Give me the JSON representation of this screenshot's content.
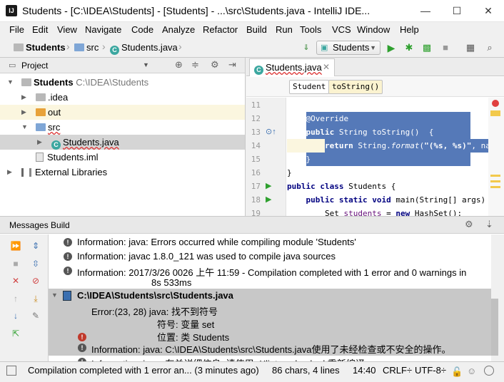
{
  "window": {
    "title": "Students - [C:\\IDEA\\Students] - [Students] - ...\\src\\Students.java - IntelliJ IDE...",
    "minimize": "—",
    "maximize": "☐",
    "close": "✕"
  },
  "menu": [
    "File",
    "Edit",
    "View",
    "Navigate",
    "Code",
    "Analyze",
    "Refactor",
    "Build",
    "Run",
    "Tools",
    "VCS",
    "Window",
    "Help"
  ],
  "navbar": {
    "crumbs": [
      "Students",
      "src",
      "Students.java"
    ],
    "run_config": "Students"
  },
  "project": {
    "header": "Project",
    "tree": [
      {
        "label": "Students",
        "extra": "C:\\IDEA\\Students"
      },
      {
        "label": ".idea"
      },
      {
        "label": "out"
      },
      {
        "label": "src"
      },
      {
        "label": "Students.java"
      },
      {
        "label": "Students.iml"
      },
      {
        "label": "External Libraries"
      }
    ]
  },
  "editor": {
    "tab": "Students.java",
    "crumbs": [
      "Student",
      "toString()"
    ],
    "line_numbers": [
      "11",
      "12",
      "13",
      "14",
      "15",
      "16",
      "17",
      "18",
      "19"
    ],
    "lines": [
      {
        "indent": "    ",
        "parts": []
      },
      {
        "indent": "    ",
        "parts": [
          [
            "ann",
            "@Override"
          ]
        ]
      },
      {
        "indent": "    ",
        "parts": [
          [
            "kw",
            "public"
          ],
          [
            "",
            " String toString()  {"
          ]
        ]
      },
      {
        "indent": "        ",
        "parts": [
          [
            "kw",
            "return"
          ],
          [
            "",
            " String."
          ],
          [
            "it",
            "format"
          ],
          [
            "",
            "("
          ],
          [
            "str",
            "\"(%s, %s)\""
          ],
          [
            "",
            ", name"
          ]
        ]
      },
      {
        "indent": "    ",
        "parts": [
          [
            "",
            "}"
          ]
        ]
      },
      {
        "indent": "",
        "parts": [
          [
            "",
            "}"
          ]
        ]
      },
      {
        "indent": "",
        "parts": [
          [
            "kw",
            "public class"
          ],
          [
            "",
            " Students {"
          ]
        ]
      },
      {
        "indent": "    ",
        "parts": [
          [
            "kw",
            "public static void"
          ],
          [
            "",
            " main(String[] args)  {"
          ]
        ]
      },
      {
        "indent": "        ",
        "parts": [
          [
            "",
            "Set "
          ],
          [
            "var",
            "students"
          ],
          [
            "",
            " = "
          ],
          [
            "kw",
            "new"
          ],
          [
            "",
            " HashSet();"
          ]
        ]
      }
    ]
  },
  "messages": {
    "header": "Messages Build",
    "rows": [
      {
        "type": "info",
        "text": "Information: java: Errors occurred while compiling module 'Students'"
      },
      {
        "type": "info",
        "text": "Information: javac 1.8.0_121 was used to compile java sources"
      },
      {
        "type": "info",
        "text": "Information: 2017/3/26 0026 上午 11:59 - Compilation completed with 1 error and 0 warnings in",
        "text2": "8s 533ms"
      },
      {
        "type": "file",
        "text": "C:\\IDEA\\Students\\src\\Students.java"
      },
      {
        "type": "error",
        "text": "Error:(23, 28)  java: 找不到符号",
        "text2": "符号:   变量 set",
        "text3": "位置: 类 Students"
      },
      {
        "type": "info",
        "text": "Information: java: C:\\IDEA\\Students\\src\\Students.java使用了未经检查或不安全的操作。"
      },
      {
        "type": "info",
        "text": "Information: java: 有关详细信息, 请使用 -Xlint:unchecked 重新编译。"
      }
    ]
  },
  "status": {
    "message": "Compilation completed with 1 error an... (3 minutes ago)",
    "chars": "86 chars, 4 lines",
    "position": "14:40",
    "line_sep": "CRLF÷",
    "encoding": "UTF-8÷"
  }
}
